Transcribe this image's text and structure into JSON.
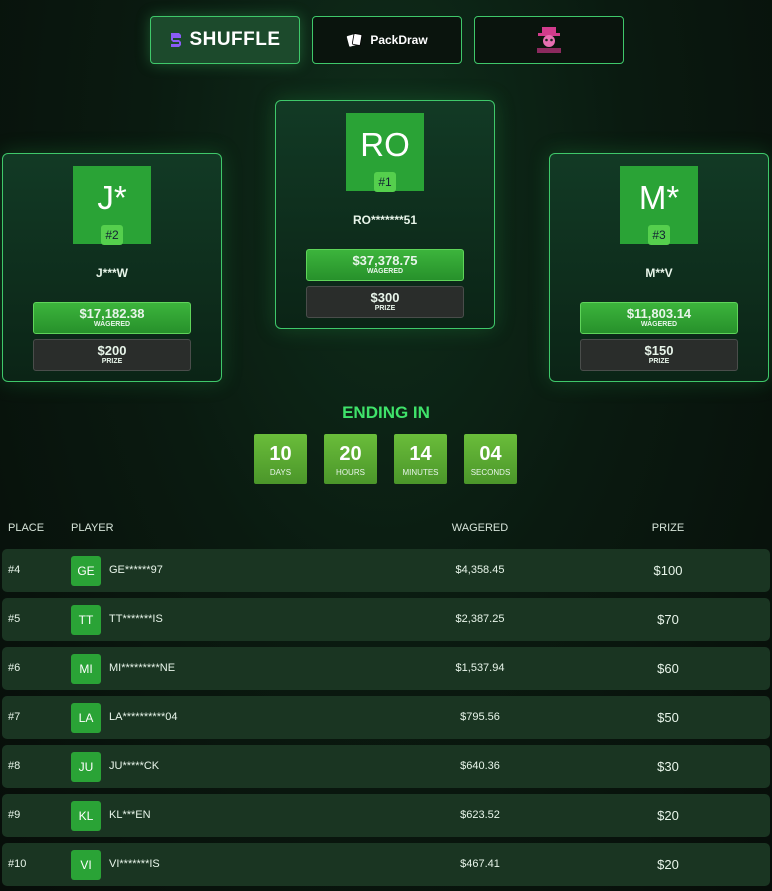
{
  "tabs": [
    {
      "label": "SHUFFLE",
      "icon": "shuffle-logo-icon",
      "active": true
    },
    {
      "label": "PackDraw",
      "icon": "cards-icon",
      "active": false
    },
    {
      "label": "",
      "icon": "mascot-logo-icon",
      "active": false
    }
  ],
  "podium": {
    "first": {
      "initials": "RO",
      "rank": "#1",
      "name": "RO*******51",
      "wagered": "$37,378.75",
      "wagered_label": "WAGERED",
      "prize": "$300",
      "prize_label": "PRIZE"
    },
    "second": {
      "initials": "J*",
      "rank": "#2",
      "name": "J***W",
      "wagered": "$17,182.38",
      "wagered_label": "WAGERED",
      "prize": "$200",
      "prize_label": "PRIZE"
    },
    "third": {
      "initials": "M*",
      "rank": "#3",
      "name": "M**V",
      "wagered": "$11,803.14",
      "wagered_label": "WAGERED",
      "prize": "$150",
      "prize_label": "PRIZE"
    }
  },
  "countdown": {
    "title": "ENDING IN",
    "days": {
      "value": "10",
      "label": "DAYS"
    },
    "hours": {
      "value": "20",
      "label": "HOURS"
    },
    "minutes": {
      "value": "14",
      "label": "MINUTES"
    },
    "seconds": {
      "value": "04",
      "label": "SECONDS"
    }
  },
  "table": {
    "headers": {
      "place": "PLACE",
      "player": "PLAYER",
      "wagered": "WAGERED",
      "prize": "PRIZE"
    },
    "rows": [
      {
        "rank": "#4",
        "initials": "GE",
        "name": "GE******97",
        "wagered": "$4,358.45",
        "prize": "$100"
      },
      {
        "rank": "#5",
        "initials": "TT",
        "name": "TT*******IS",
        "wagered": "$2,387.25",
        "prize": "$70"
      },
      {
        "rank": "#6",
        "initials": "MI",
        "name": "MI*********NE",
        "wagered": "$1,537.94",
        "prize": "$60"
      },
      {
        "rank": "#7",
        "initials": "LA",
        "name": "LA**********04",
        "wagered": "$795.56",
        "prize": "$50"
      },
      {
        "rank": "#8",
        "initials": "JU",
        "name": "JU*****CK",
        "wagered": "$640.36",
        "prize": "$30"
      },
      {
        "rank": "#9",
        "initials": "KL",
        "name": "KL***EN",
        "wagered": "$623.52",
        "prize": "$20"
      },
      {
        "rank": "#10",
        "initials": "VI",
        "name": "VI*******IS",
        "wagered": "$467.41",
        "prize": "$20"
      }
    ]
  },
  "colors": {
    "accent": "#3fc86a",
    "avatar": "#2aa336",
    "ending_title": "#3fe26a"
  }
}
